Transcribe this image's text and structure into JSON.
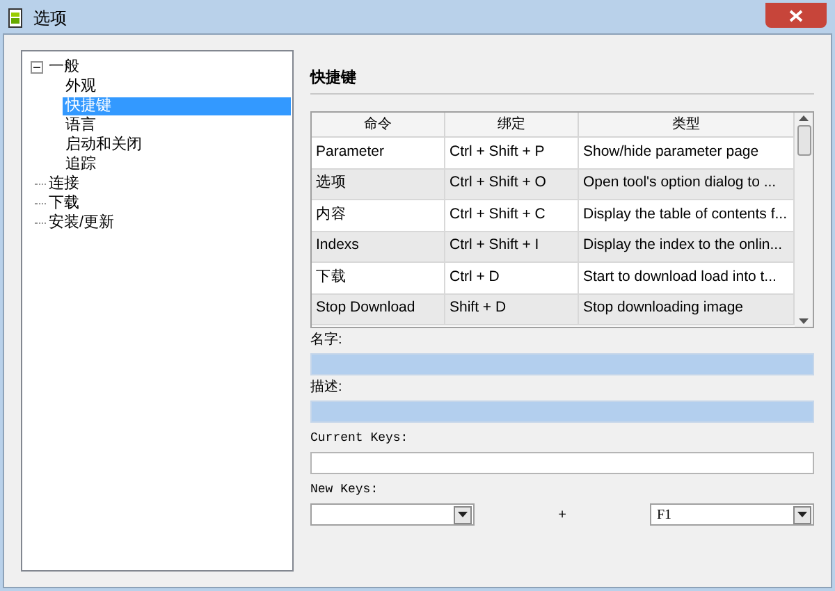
{
  "window": {
    "title": "选项"
  },
  "tree": [
    {
      "label": "一般",
      "expanded": true,
      "selected": false,
      "children": [
        {
          "label": "外观",
          "selected": false
        },
        {
          "label": "快捷键",
          "selected": true
        },
        {
          "label": "语言",
          "selected": false
        },
        {
          "label": "启动和关闭",
          "selected": false
        },
        {
          "label": "追踪",
          "selected": false
        }
      ]
    },
    {
      "label": "连接",
      "selected": false
    },
    {
      "label": "下载",
      "selected": false
    },
    {
      "label": "安装/更新",
      "selected": false
    }
  ],
  "section_title": "快捷键",
  "table": {
    "columns": [
      "命令",
      "绑定",
      "类型"
    ],
    "rows": [
      [
        "Parameter",
        "Ctrl + Shift + P",
        "Show/hide parameter page"
      ],
      [
        "选项",
        "Ctrl + Shift + O",
        "Open tool's option dialog to ..."
      ],
      [
        "内容",
        "Ctrl + Shift + C",
        "Display the table of contents f..."
      ],
      [
        "Indexs",
        "Ctrl + Shift + I",
        "Display the index to the onlin..."
      ],
      [
        "下载",
        "Ctrl + D",
        "Start to download load into t..."
      ],
      [
        "Stop Download",
        "Shift + D",
        "Stop downloading image"
      ]
    ]
  },
  "name_label": "名字:",
  "description_label": "描述:",
  "current_keys_label": "Current Keys:",
  "new_keys_label": "New Keys:",
  "plus": "+",
  "key_value": "F1"
}
